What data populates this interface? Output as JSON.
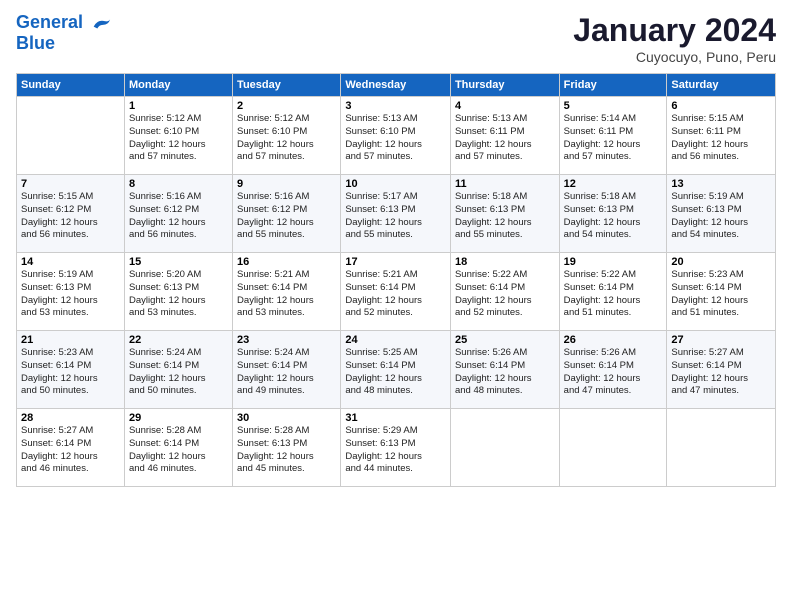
{
  "logo": {
    "line1": "General",
    "line2": "Blue"
  },
  "title": "January 2024",
  "subtitle": "Cuyocuyo, Puno, Peru",
  "days_of_week": [
    "Sunday",
    "Monday",
    "Tuesday",
    "Wednesday",
    "Thursday",
    "Friday",
    "Saturday"
  ],
  "weeks": [
    [
      {
        "num": "",
        "info": ""
      },
      {
        "num": "1",
        "info": "Sunrise: 5:12 AM\nSunset: 6:10 PM\nDaylight: 12 hours\nand 57 minutes."
      },
      {
        "num": "2",
        "info": "Sunrise: 5:12 AM\nSunset: 6:10 PM\nDaylight: 12 hours\nand 57 minutes."
      },
      {
        "num": "3",
        "info": "Sunrise: 5:13 AM\nSunset: 6:10 PM\nDaylight: 12 hours\nand 57 minutes."
      },
      {
        "num": "4",
        "info": "Sunrise: 5:13 AM\nSunset: 6:11 PM\nDaylight: 12 hours\nand 57 minutes."
      },
      {
        "num": "5",
        "info": "Sunrise: 5:14 AM\nSunset: 6:11 PM\nDaylight: 12 hours\nand 57 minutes."
      },
      {
        "num": "6",
        "info": "Sunrise: 5:15 AM\nSunset: 6:11 PM\nDaylight: 12 hours\nand 56 minutes."
      }
    ],
    [
      {
        "num": "7",
        "info": "Sunrise: 5:15 AM\nSunset: 6:12 PM\nDaylight: 12 hours\nand 56 minutes."
      },
      {
        "num": "8",
        "info": "Sunrise: 5:16 AM\nSunset: 6:12 PM\nDaylight: 12 hours\nand 56 minutes."
      },
      {
        "num": "9",
        "info": "Sunrise: 5:16 AM\nSunset: 6:12 PM\nDaylight: 12 hours\nand 55 minutes."
      },
      {
        "num": "10",
        "info": "Sunrise: 5:17 AM\nSunset: 6:13 PM\nDaylight: 12 hours\nand 55 minutes."
      },
      {
        "num": "11",
        "info": "Sunrise: 5:18 AM\nSunset: 6:13 PM\nDaylight: 12 hours\nand 55 minutes."
      },
      {
        "num": "12",
        "info": "Sunrise: 5:18 AM\nSunset: 6:13 PM\nDaylight: 12 hours\nand 54 minutes."
      },
      {
        "num": "13",
        "info": "Sunrise: 5:19 AM\nSunset: 6:13 PM\nDaylight: 12 hours\nand 54 minutes."
      }
    ],
    [
      {
        "num": "14",
        "info": "Sunrise: 5:19 AM\nSunset: 6:13 PM\nDaylight: 12 hours\nand 53 minutes."
      },
      {
        "num": "15",
        "info": "Sunrise: 5:20 AM\nSunset: 6:13 PM\nDaylight: 12 hours\nand 53 minutes."
      },
      {
        "num": "16",
        "info": "Sunrise: 5:21 AM\nSunset: 6:14 PM\nDaylight: 12 hours\nand 53 minutes."
      },
      {
        "num": "17",
        "info": "Sunrise: 5:21 AM\nSunset: 6:14 PM\nDaylight: 12 hours\nand 52 minutes."
      },
      {
        "num": "18",
        "info": "Sunrise: 5:22 AM\nSunset: 6:14 PM\nDaylight: 12 hours\nand 52 minutes."
      },
      {
        "num": "19",
        "info": "Sunrise: 5:22 AM\nSunset: 6:14 PM\nDaylight: 12 hours\nand 51 minutes."
      },
      {
        "num": "20",
        "info": "Sunrise: 5:23 AM\nSunset: 6:14 PM\nDaylight: 12 hours\nand 51 minutes."
      }
    ],
    [
      {
        "num": "21",
        "info": "Sunrise: 5:23 AM\nSunset: 6:14 PM\nDaylight: 12 hours\nand 50 minutes."
      },
      {
        "num": "22",
        "info": "Sunrise: 5:24 AM\nSunset: 6:14 PM\nDaylight: 12 hours\nand 50 minutes."
      },
      {
        "num": "23",
        "info": "Sunrise: 5:24 AM\nSunset: 6:14 PM\nDaylight: 12 hours\nand 49 minutes."
      },
      {
        "num": "24",
        "info": "Sunrise: 5:25 AM\nSunset: 6:14 PM\nDaylight: 12 hours\nand 48 minutes."
      },
      {
        "num": "25",
        "info": "Sunrise: 5:26 AM\nSunset: 6:14 PM\nDaylight: 12 hours\nand 48 minutes."
      },
      {
        "num": "26",
        "info": "Sunrise: 5:26 AM\nSunset: 6:14 PM\nDaylight: 12 hours\nand 47 minutes."
      },
      {
        "num": "27",
        "info": "Sunrise: 5:27 AM\nSunset: 6:14 PM\nDaylight: 12 hours\nand 47 minutes."
      }
    ],
    [
      {
        "num": "28",
        "info": "Sunrise: 5:27 AM\nSunset: 6:14 PM\nDaylight: 12 hours\nand 46 minutes."
      },
      {
        "num": "29",
        "info": "Sunrise: 5:28 AM\nSunset: 6:14 PM\nDaylight: 12 hours\nand 46 minutes."
      },
      {
        "num": "30",
        "info": "Sunrise: 5:28 AM\nSunset: 6:13 PM\nDaylight: 12 hours\nand 45 minutes."
      },
      {
        "num": "31",
        "info": "Sunrise: 5:29 AM\nSunset: 6:13 PM\nDaylight: 12 hours\nand 44 minutes."
      },
      {
        "num": "",
        "info": ""
      },
      {
        "num": "",
        "info": ""
      },
      {
        "num": "",
        "info": ""
      }
    ]
  ]
}
